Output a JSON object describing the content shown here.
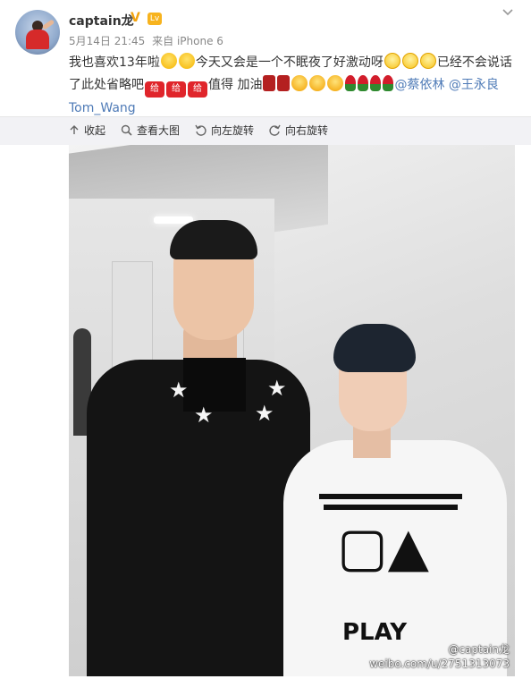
{
  "user": {
    "name": "captain龙",
    "verified_badge": "V",
    "level_badge": "Lv"
  },
  "meta": {
    "date": "5月14日 21:45",
    "source": "来自 iPhone 6"
  },
  "post": {
    "text_1": "我也喜欢13年啦",
    "text_2": "今天又会是一个不眠夜了好激动呀",
    "text_3": "已经不会说话了此处省略吧",
    "give_emoji_label": "给",
    "text_4": "值得 加油",
    "mention_1": "@蔡依林",
    "mention_2": "@王永良Tom_Wang"
  },
  "toolbar": {
    "collapse_label": "收起",
    "view_large_label": "查看大图",
    "rotate_left_label": "向左旋转",
    "rotate_right_label": "向右旋转"
  },
  "photo": {
    "watermark_user": "@captain龙",
    "watermark_url": "weibo.com/u/2751313073",
    "shirt_text_play": "PLAY"
  },
  "colors": {
    "mention": "#4f7bb7",
    "verified": "#f2a30f",
    "bar_bg": "#f2f2f5"
  }
}
